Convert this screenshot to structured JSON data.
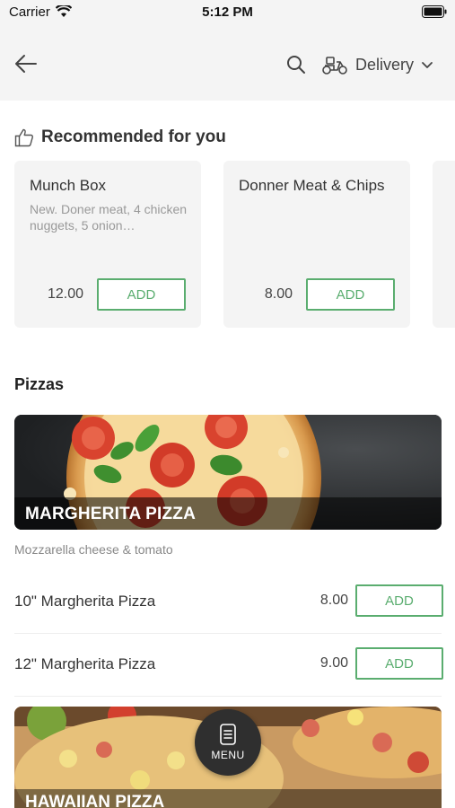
{
  "status_bar": {
    "carrier": "Carrier",
    "time": "5:12 PM"
  },
  "header": {
    "back_icon": "arrow-left-icon",
    "search_icon": "search-icon",
    "delivery_icon": "scooter-icon",
    "delivery_label": "Delivery",
    "chevron_icon": "chevron-down-icon"
  },
  "recommended": {
    "title": "Recommended for you",
    "icon": "thumbs-up-icon",
    "cards": [
      {
        "name": "Munch Box",
        "description": "New. Doner meat, 4 chicken nuggets, 5 onion…",
        "price": "12.00",
        "add_label": "ADD"
      },
      {
        "name": "Donner Meat & Chips",
        "description": "",
        "price": "8.00",
        "add_label": "ADD"
      }
    ]
  },
  "category": {
    "title": "Pizzas",
    "banner_title": "MARGHERITA PIZZA",
    "description": "Mozzarella cheese & tomato",
    "items": [
      {
        "name": "10\" Margherita Pizza",
        "price": "8.00",
        "add_label": "ADD"
      },
      {
        "name": "12\" Margherita Pizza",
        "price": "9.00",
        "add_label": "ADD"
      }
    ],
    "next_banner_title": "HAWAIIAN PIZZA"
  },
  "menu_button": {
    "label": "MENU",
    "icon": "menu-list-icon"
  },
  "colors": {
    "accent": "#5aad6f",
    "header_bg": "#f4f4f4",
    "card_bg": "#f4f4f4",
    "fab_bg": "#2f2f2f"
  }
}
